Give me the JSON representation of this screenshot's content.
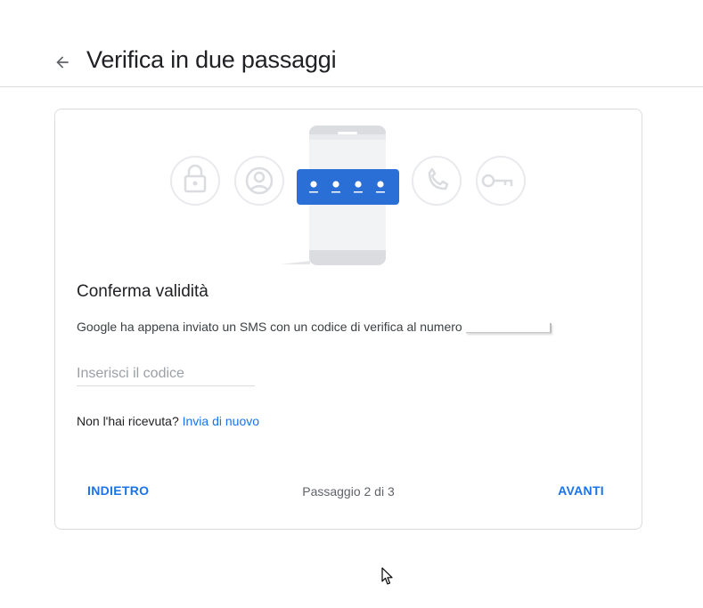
{
  "header": {
    "title": "Verifica in due passaggi",
    "back_icon": "arrow-back-icon"
  },
  "card": {
    "title": "Conferma validità",
    "description": "Google ha appena inviato un SMS con un codice di verifica al numero",
    "code_input": {
      "placeholder": "Inserisci il codice",
      "value": ""
    },
    "resend_prompt": "Non l'hai ricevuta?",
    "resend_link": "Invia di nuovo",
    "back_button": "INDIETRO",
    "step_text": "Passaggio 2 di 3",
    "next_button": "AVANTI",
    "illustration_icons": [
      "lock-icon",
      "account-icon",
      "phone-icon",
      "key-icon"
    ]
  },
  "colors": {
    "accent": "#1a73e8",
    "text_primary": "#202124",
    "text_secondary": "#5f6368",
    "border": "#dadce0",
    "code_banner": "#2a6fd6"
  }
}
